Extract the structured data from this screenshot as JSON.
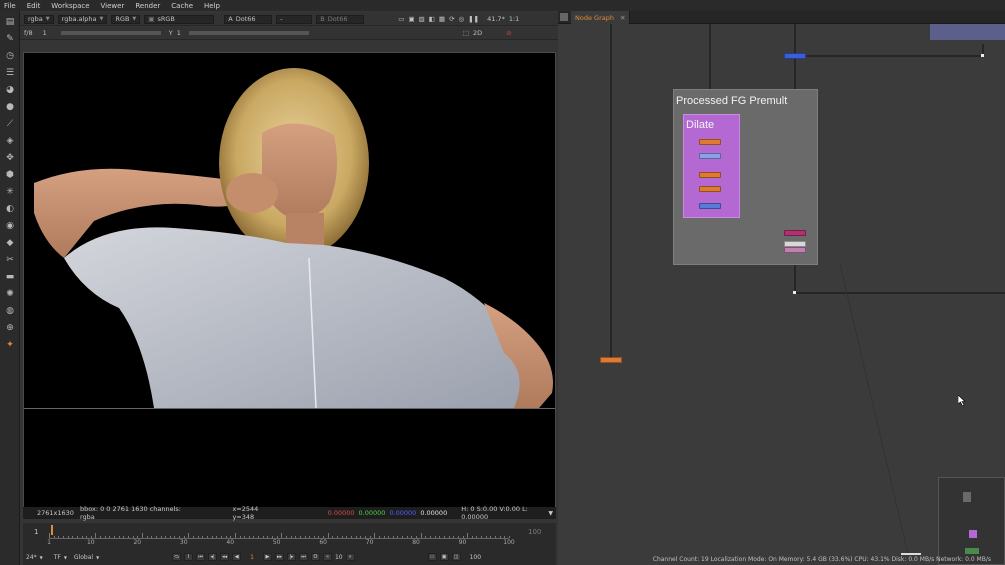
{
  "menu": [
    "File",
    "Edit",
    "Workspace",
    "Viewer",
    "Render",
    "Cache",
    "Help"
  ],
  "viewer_bar1": {
    "layer": "rgba",
    "channel": "rgba.alpha",
    "display": "RGB",
    "colorspace": "sRGB",
    "input_a_letter": "A",
    "input_a": "Dot66",
    "input_mid": "-",
    "input_b_letter": "B",
    "input_b": "Dot66",
    "zoom": "41.7*",
    "ratio": "1:1"
  },
  "viewer_bar2": {
    "fstop": "f/8",
    "frame_val": "1",
    "y_label": "Y",
    "y_val": "1",
    "view_mode": "2D"
  },
  "infobar": {
    "resolution": "2761x1630",
    "bbox": "bbox: 0 0 2761 1630 channels: rgba",
    "coords": "x=2544 y=348",
    "r": "0.00000",
    "g": "0.00000",
    "b": "0.00000",
    "a": "0.00000",
    "hsvl": "H:  0 S:0.00 V:0.00  L: 0.00000"
  },
  "timeline": {
    "start": "1",
    "end": "100",
    "ticks": [
      "1",
      "10",
      "20",
      "30",
      "40",
      "50",
      "60",
      "70",
      "80",
      "90",
      "100"
    ],
    "fps": "24*",
    "tf": "TF",
    "scope": "Global",
    "current_frame": "1",
    "step": "10",
    "out_frame": "100"
  },
  "node_graph": {
    "tab_label": "Node Graph",
    "backdrop_label": "Processed FG Premult",
    "dilate_label": "Dilate",
    "colors": {
      "orange": "#e07a30",
      "blue": "#5a7ad8",
      "lightblue": "#8aa0e8",
      "magenta": "#b03070",
      "backdrop": "#6a6a6a",
      "dilate": "#b468d2"
    }
  },
  "status": "Channel Count: 19  Localization Mode: On  Memory: 5.4 GB (33.6%)  CPU: 43.1%  Disk: 0.0 MB/s  Network: 0.0 MB/s",
  "icons": [
    "viewer-icon",
    "draw-icon",
    "time-icon",
    "channel-icon",
    "color-icon",
    "filter-icon",
    "keyer-icon",
    "merge-icon",
    "transform-icon",
    "3d-icon",
    "particles-icon",
    "deep-icon",
    "views-icon",
    "metadata-icon",
    "toolsets-icon",
    "other-icon",
    "furnace-icon",
    "ocio-icon",
    "nuke-icon"
  ]
}
